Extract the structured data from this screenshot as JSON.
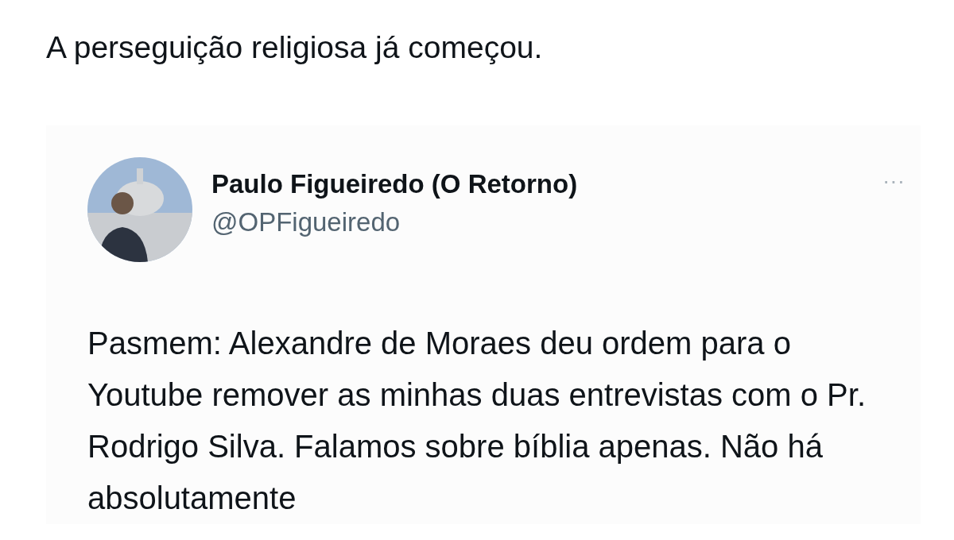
{
  "post": {
    "text": "A perseguição religiosa já começou."
  },
  "quoted": {
    "name": "Paulo Figueiredo (O Retorno)",
    "handle": "@OPFigueiredo",
    "more": "···",
    "text": "Pasmem: Alexandre de Moraes deu ordem para o Youtube remover as minhas duas entrevistas com o Pr. Rodrigo Silva. Falamos sobre bíblia apenas. Não há absolutamente"
  }
}
